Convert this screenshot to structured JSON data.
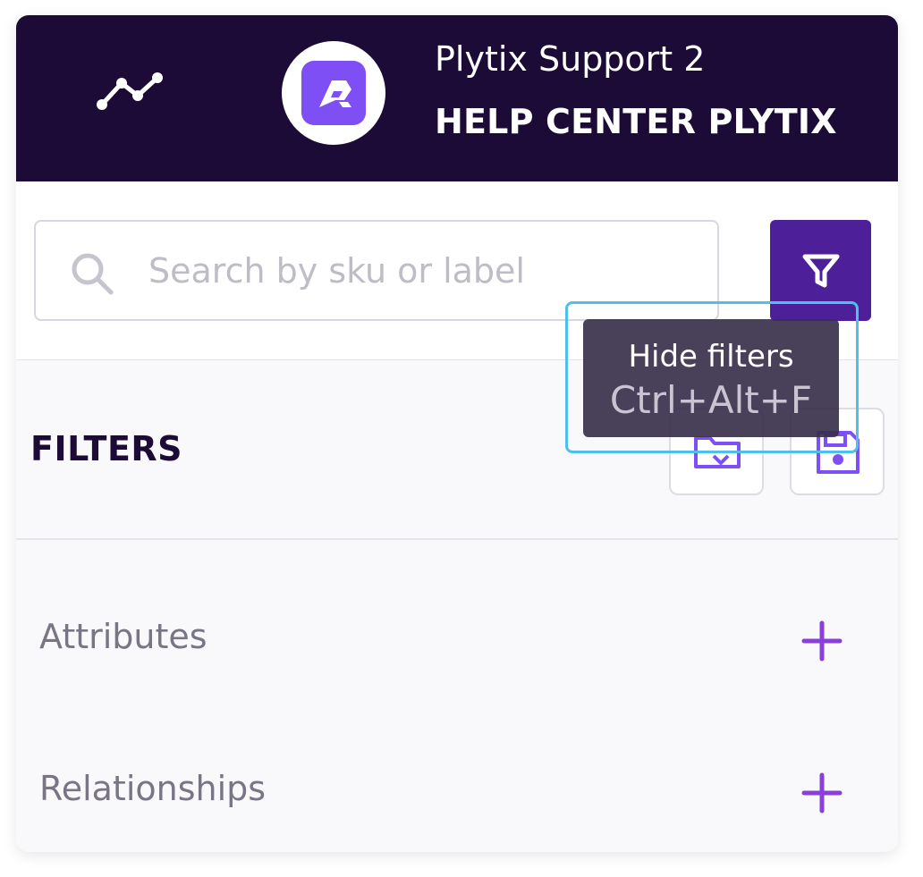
{
  "header": {
    "account_name": "Plytix Support 2",
    "account_org": "HELP CENTER PLYTIX",
    "icons": {
      "trend": "trend-line-icon",
      "logo": "plytix-logo-icon"
    },
    "background": "#1d0b37"
  },
  "search": {
    "placeholder": "Search by sku or label",
    "value": ""
  },
  "filter_toggle": {
    "icon": "funnel-icon",
    "color": "#4d1f99"
  },
  "tooltip": {
    "title": "Hide filters",
    "shortcut": "Ctrl+Alt+F"
  },
  "filters": {
    "title": "FILTERS",
    "actions": [
      {
        "icon": "folder-open-icon"
      },
      {
        "icon": "save-icon"
      }
    ]
  },
  "sections": [
    {
      "label": "Attributes",
      "action_icon": "plus-icon"
    },
    {
      "label": "Relationships",
      "action_icon": "plus-icon"
    }
  ],
  "colors": {
    "accent": "#7d4ff5",
    "accent_dark": "#4d1f99",
    "focus_ring": "#4fc0e9"
  }
}
